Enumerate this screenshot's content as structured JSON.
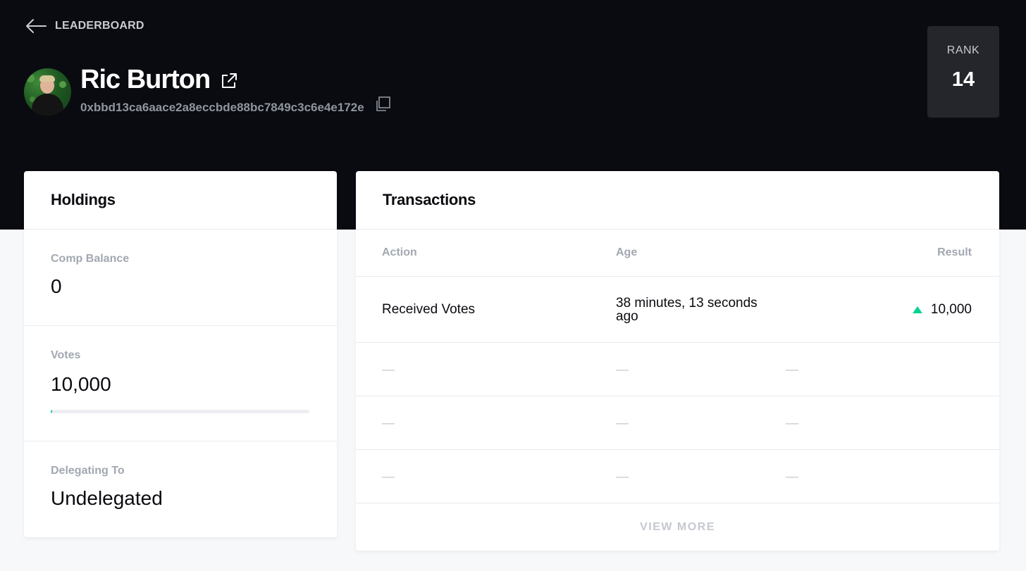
{
  "nav": {
    "back_label": "LEADERBOARD"
  },
  "profile": {
    "name": "Ric Burton",
    "address": "0xbbd13ca6aace2a8eccbde88bc7849c3c6e4e172e"
  },
  "rank": {
    "label": "RANK",
    "value": "14"
  },
  "holdings": {
    "title": "Holdings",
    "comp_balance": {
      "label": "Comp Balance",
      "value": "0"
    },
    "votes": {
      "label": "Votes",
      "value": "10,000",
      "progress_percent": 0.5
    },
    "delegating": {
      "label": "Delegating To",
      "value": "Undelegated"
    }
  },
  "transactions": {
    "title": "Transactions",
    "columns": {
      "action": "Action",
      "age": "Age",
      "result": "Result"
    },
    "rows": [
      {
        "action": "Received Votes",
        "age": "38 minutes, 13 seconds ago",
        "result": "10,000",
        "direction": "up"
      }
    ],
    "empty_rows": [
      {
        "action": "—",
        "age": "—",
        "result": "—"
      },
      {
        "action": "—",
        "age": "—",
        "result": "—"
      },
      {
        "action": "—",
        "age": "—",
        "result": "—"
      }
    ],
    "view_more_label": "VIEW MORE"
  },
  "colors": {
    "header_bg": "#0a0b10",
    "accent_green": "#00d395",
    "rank_bg": "#24262b",
    "muted_text": "#a2a8b1"
  },
  "icons": [
    "back-arrow-icon",
    "external-link-icon",
    "copy-icon",
    "up-triangle-icon"
  ]
}
